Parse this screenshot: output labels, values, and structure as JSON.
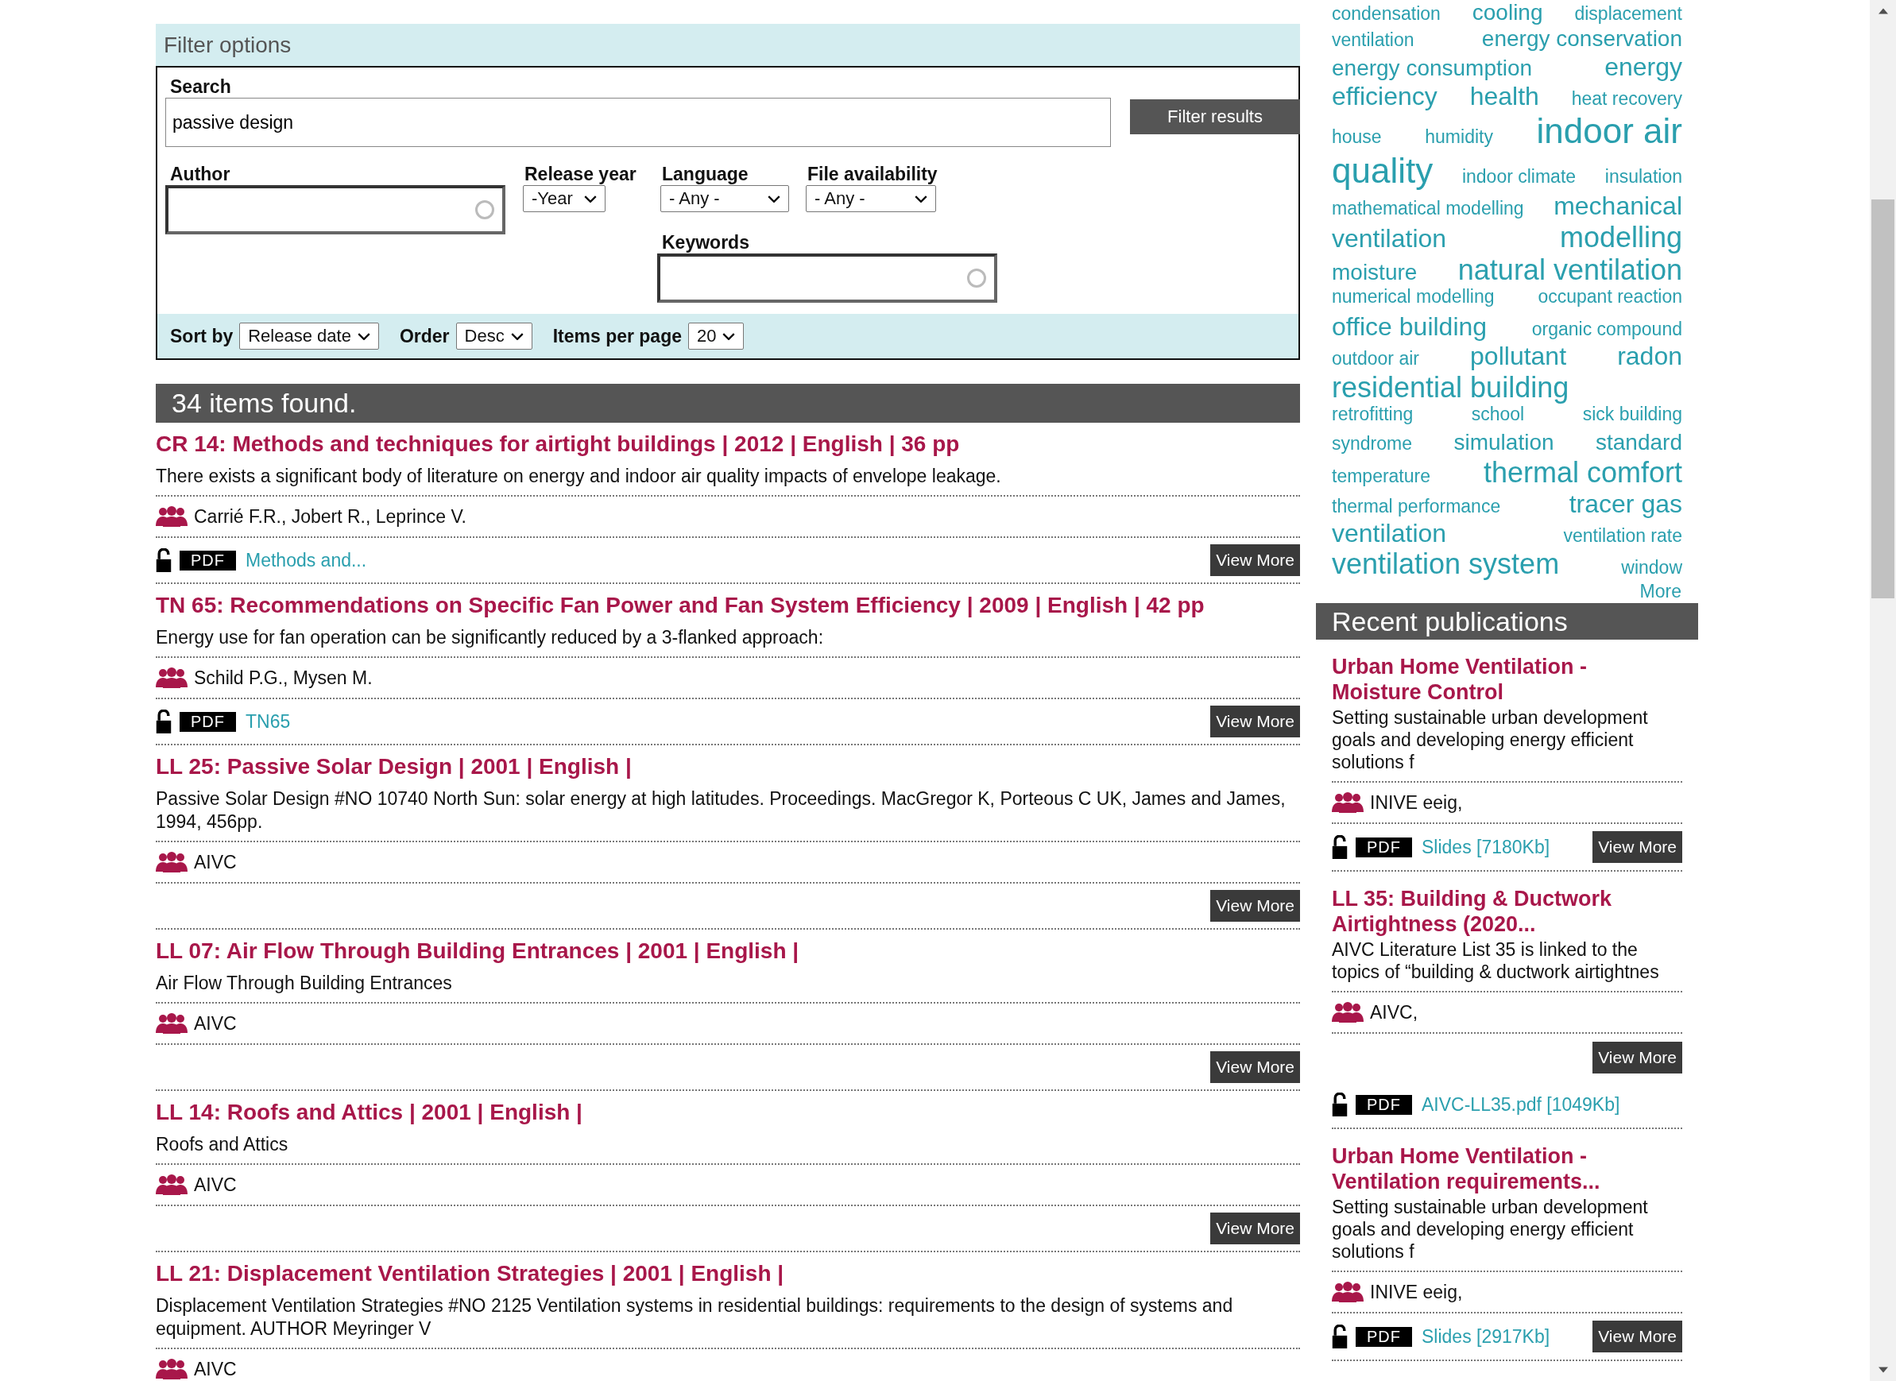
{
  "filter": {
    "title": "Filter options",
    "search": {
      "label": "Search",
      "value": "passive design"
    },
    "submit": "Filter results",
    "author": {
      "label": "Author"
    },
    "selects": [
      {
        "label": "Release year",
        "value": "-Year"
      },
      {
        "label": "Language",
        "value": "- Any -"
      },
      {
        "label": "File availability",
        "value": "- Any -"
      }
    ],
    "keywords": {
      "label": "Keywords"
    },
    "sort": [
      {
        "label": "Sort by",
        "value": "Release date"
      },
      {
        "label": "Order",
        "value": "Desc"
      },
      {
        "label": "Items per page",
        "value": "20"
      }
    ]
  },
  "results": {
    "count": "34 items found.",
    "items": [
      {
        "title": "CR 14: Methods and techniques for airtight buildings | 2012 | English | 36 pp",
        "summary": "There exists a significant body of literature on energy and indoor air quality impacts of envelope leakage.",
        "authors": "Carrié F.R., Jobert R., Leprince V.",
        "file": {
          "type": "PDF",
          "link": "Methods and..."
        },
        "button": "View More"
      },
      {
        "title": "TN 65: Recommendations on Specific Fan Power and Fan System Efficiency | 2009 | English | 42 pp",
        "summary": "Energy use for fan operation can be significantly reduced by a 3-flanked approach:",
        "authors": "Schild P.G., Mysen M.",
        "file": {
          "type": "PDF",
          "link": "TN65"
        },
        "button": "View More"
      },
      {
        "title": "LL 25: Passive Solar Design | 2001 | English |",
        "summary": "Passive Solar Design #NO 10740 North Sun: solar energy at high latitudes. Proceedings. MacGregor K, Porteous C UK, James and James, 1994, 456pp.",
        "authors": "AIVC",
        "button": "View More"
      },
      {
        "title": "LL 07: Air Flow Through Building Entrances | 2001 | English |",
        "summary": "Air Flow Through Building Entrances",
        "authors": "AIVC",
        "button": "View More"
      },
      {
        "title": "LL 14: Roofs and Attics | 2001 | English |",
        "summary": "Roofs and Attics",
        "authors": "AIVC",
        "button": "View More"
      },
      {
        "title": "LL 21: Displacement Ventilation Strategies | 2001 | English |",
        "summary": "Displacement Ventilation Strategies #NO 2125 Ventilation systems in residential buildings: requirements to the design of systems and equipment. AUTHOR Meyringer V",
        "authors": "AIVC"
      }
    ]
  },
  "tag_cloud": {
    "lines": [
      [
        {
          "label": "condensation",
          "kind": "small"
        },
        {
          "label": "cooling",
          "kind": "medium"
        },
        {
          "label": "displacement",
          "kind": "small"
        }
      ],
      [
        {
          "label": "ventilation",
          "kind": "small"
        },
        {
          "label": "energy conservation",
          "kind": "medium"
        }
      ],
      [
        {
          "label": "energy consumption",
          "kind": "medium"
        },
        {
          "label": "energy",
          "kind": "large"
        }
      ],
      [
        {
          "label": "efficiency",
          "kind": "large"
        },
        {
          "label": "health",
          "kind": "large"
        },
        {
          "label": "heat recovery",
          "kind": "small"
        }
      ],
      [
        {
          "label": "house",
          "kind": "small"
        },
        {
          "label": "humidity",
          "kind": "small"
        },
        {
          "label": "indoor air",
          "kind": "huge"
        }
      ],
      [
        {
          "label": "quality",
          "kind": "huge"
        },
        {
          "label": "indoor climate",
          "kind": "small"
        },
        {
          "label": "insulation",
          "kind": "small"
        }
      ],
      [
        {
          "label": "mathematical modelling",
          "kind": "small"
        },
        {
          "label": "mechanical",
          "kind": "large"
        }
      ],
      [
        {
          "label": "ventilation",
          "kind": "large"
        },
        {
          "label": "modelling",
          "kind": "xlarge"
        }
      ],
      [
        {
          "label": "moisture",
          "kind": "medium"
        },
        {
          "label": "natural ventilation",
          "kind": "xlarge"
        }
      ],
      [
        {
          "label": "numerical modelling",
          "kind": "small"
        },
        {
          "label": "occupant reaction",
          "kind": "small"
        }
      ],
      [
        {
          "label": "office building",
          "kind": "large"
        },
        {
          "label": "organic compound",
          "kind": "small"
        }
      ],
      [
        {
          "label": "outdoor air",
          "kind": "small"
        },
        {
          "label": "pollutant",
          "kind": "large"
        },
        {
          "label": "radon",
          "kind": "large"
        }
      ],
      [
        {
          "label": "residential building",
          "kind": "xlarge"
        }
      ],
      [
        {
          "label": "retrofitting",
          "kind": "small"
        },
        {
          "label": "school",
          "kind": "small"
        },
        {
          "label": "sick building",
          "kind": "small"
        }
      ],
      [
        {
          "label": "syndrome",
          "kind": "small"
        },
        {
          "label": "simulation",
          "kind": "medium"
        },
        {
          "label": "standard",
          "kind": "medium"
        }
      ],
      [
        {
          "label": "temperature",
          "kind": "small"
        },
        {
          "label": "thermal comfort",
          "kind": "xlarge"
        }
      ],
      [
        {
          "label": "thermal performance",
          "kind": "small"
        },
        {
          "label": "tracer gas",
          "kind": "large"
        }
      ],
      [
        {
          "label": "ventilation",
          "kind": "large"
        },
        {
          "label": "ventilation rate",
          "kind": "small"
        }
      ],
      [
        {
          "label": "ventilation system",
          "kind": "xlarge"
        },
        {
          "label": "window",
          "kind": "small"
        }
      ]
    ],
    "more": "More"
  },
  "recent": {
    "title": "Recent publications",
    "items": [
      {
        "kind": "file-first",
        "title": "Urban Home Ventilation - Moisture Control",
        "summary": "Setting sustainable urban development goals and developing energy efficient solutions f",
        "authors": "INIVE eeig,",
        "file": {
          "type": "PDF",
          "link": "Slides [7180Kb]"
        },
        "button": "View More"
      },
      {
        "kind": "button-first",
        "title": "LL 35: Building & Ductwork Airtightness (2020...",
        "summary": "AIVC Literature List 35 is linked to the topics of “building & ductwork airtightnes",
        "authors": "AIVC,",
        "file": {
          "type": "PDF",
          "link": "AIVC-LL35.pdf [1049Kb]"
        },
        "button": "View More"
      },
      {
        "kind": "file-first",
        "title": "Urban Home Ventilation - Ventilation requirements...",
        "summary": "Setting sustainable urban development goals and developing energy efficient solutions f",
        "authors": "INIVE eeig,",
        "file": {
          "type": "PDF",
          "link": "Slides [2917Kb]"
        },
        "button": "View More"
      }
    ]
  }
}
